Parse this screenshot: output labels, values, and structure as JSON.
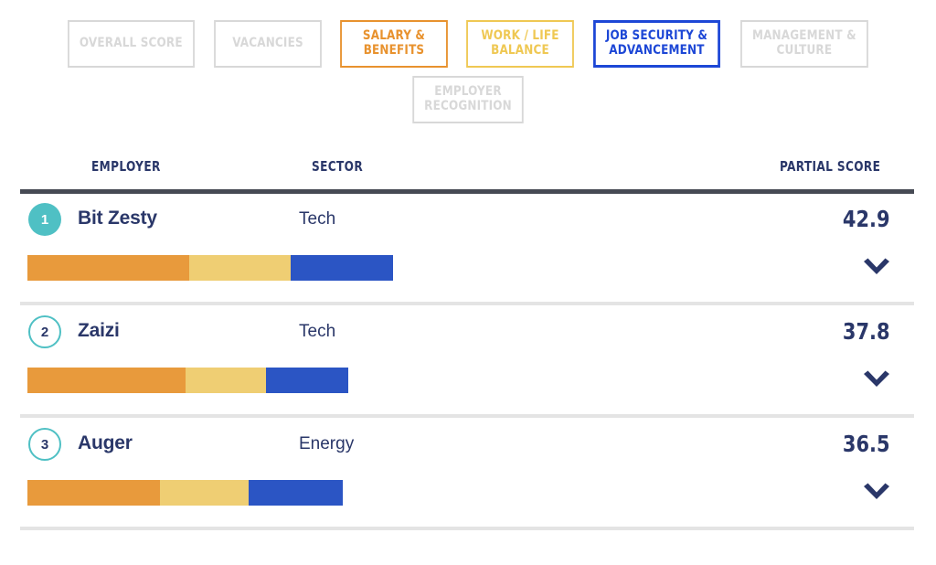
{
  "tabs": {
    "row1": [
      {
        "label": "OVERALL SCORE",
        "state": "inactive",
        "color": "#d8d8d8"
      },
      {
        "label": "VACANCIES",
        "state": "inactive",
        "color": "#d8d8d8"
      },
      {
        "label_line1": "SALARY &",
        "label_line2": "BENEFITS",
        "state": "colored",
        "color": "#E8922E"
      },
      {
        "label_line1": "WORK / LIFE",
        "label_line2": "BALANCE",
        "state": "colored",
        "color": "#EFC853"
      },
      {
        "label_line1": "JOB SECURITY &",
        "label_line2": "ADVANCEMENT",
        "state": "selected",
        "color": "#1D47D6"
      },
      {
        "label_line1": "MANAGEMENT &",
        "label_line2": "CULTURE",
        "state": "inactive",
        "color": "#d8d8d8"
      }
    ],
    "row2": [
      {
        "label_line1": "EMPLOYER",
        "label_line2": "RECOGNITION",
        "state": "inactive",
        "color": "#d8d8d8"
      }
    ]
  },
  "table": {
    "headers": {
      "employer": "EMPLOYER",
      "sector": "SECTOR",
      "score": "PARTIAL SCORE"
    },
    "rows": [
      {
        "rank": "1",
        "rank_style": "filled",
        "employer": "Bit Zesty",
        "sector": "Tech",
        "score": "42.9",
        "bar": {
          "orange": 177,
          "yellow": 111,
          "blue": 112
        },
        "chevron": "chevron-down-icon"
      },
      {
        "rank": "2",
        "rank_style": "outline",
        "employer": "Zaizi",
        "sector": "Tech",
        "score": "37.8",
        "bar": {
          "orange": 173,
          "yellow": 88,
          "blue": 90
        },
        "chevron": "chevron-down-icon"
      },
      {
        "rank": "3",
        "rank_style": "outline",
        "employer": "Auger",
        "sector": "Energy",
        "score": "36.5",
        "bar": {
          "orange": 145,
          "yellow": 97,
          "blue": 103
        },
        "chevron": "chevron-down-icon"
      }
    ]
  },
  "colors": {
    "navy": "#2A3769",
    "teal": "#4FC0C4",
    "orange": "#E89A3C",
    "yellow": "#EFCE73",
    "blue": "#2B55C4",
    "rule": "#464A54",
    "divider": "#E4E4E4"
  }
}
